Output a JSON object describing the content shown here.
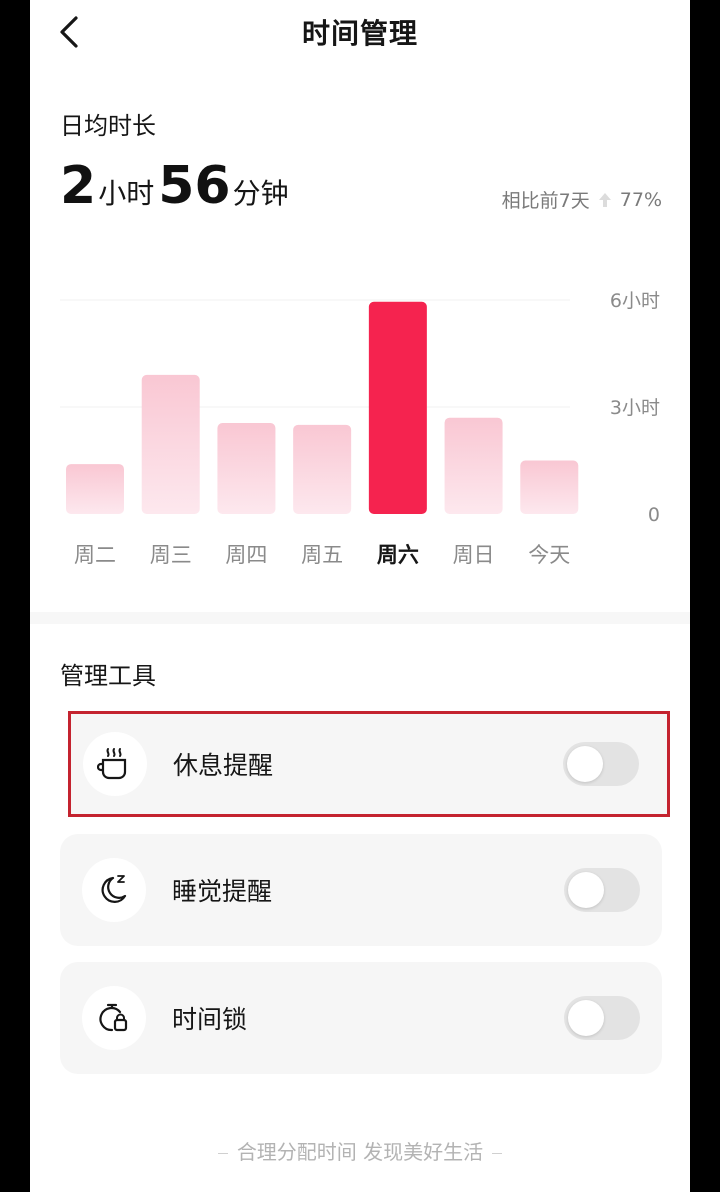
{
  "header": {
    "title": "时间管理",
    "back_icon": "chevron-left-icon"
  },
  "summary": {
    "label": "日均时长",
    "hours": "2",
    "hours_unit": "小时",
    "minutes": "56",
    "minutes_unit": "分钟",
    "compare_text": "相比前7天",
    "compare_change": "77%",
    "trend_icon": "arrow-up-icon"
  },
  "chart_data": {
    "type": "bar",
    "categories": [
      "周二",
      "周三",
      "周四",
      "周五",
      "周六",
      "周日",
      "今天"
    ],
    "values": [
      1.4,
      3.9,
      2.55,
      2.5,
      5.95,
      2.7,
      1.5
    ],
    "highlight_index": 4,
    "ylim": [
      0,
      6
    ],
    "yticks": [
      0,
      3,
      6
    ],
    "ytick_labels": [
      "0",
      "3小时",
      "6小时"
    ],
    "colors": {
      "highlight": "#f5234f",
      "bar_top": "#f9c7d3",
      "bar_bottom": "#fde8ee",
      "grid": "#f0f0f0"
    }
  },
  "tools": {
    "label": "管理工具",
    "items": [
      {
        "label": "休息提醒",
        "icon": "coffee-cup-icon",
        "enabled": false
      },
      {
        "label": "睡觉提醒",
        "icon": "moon-sleep-icon",
        "enabled": false
      },
      {
        "label": "时间锁",
        "icon": "timer-lock-icon",
        "enabled": false
      }
    ]
  },
  "footer": {
    "text": "合理分配时间 发现美好生活"
  }
}
